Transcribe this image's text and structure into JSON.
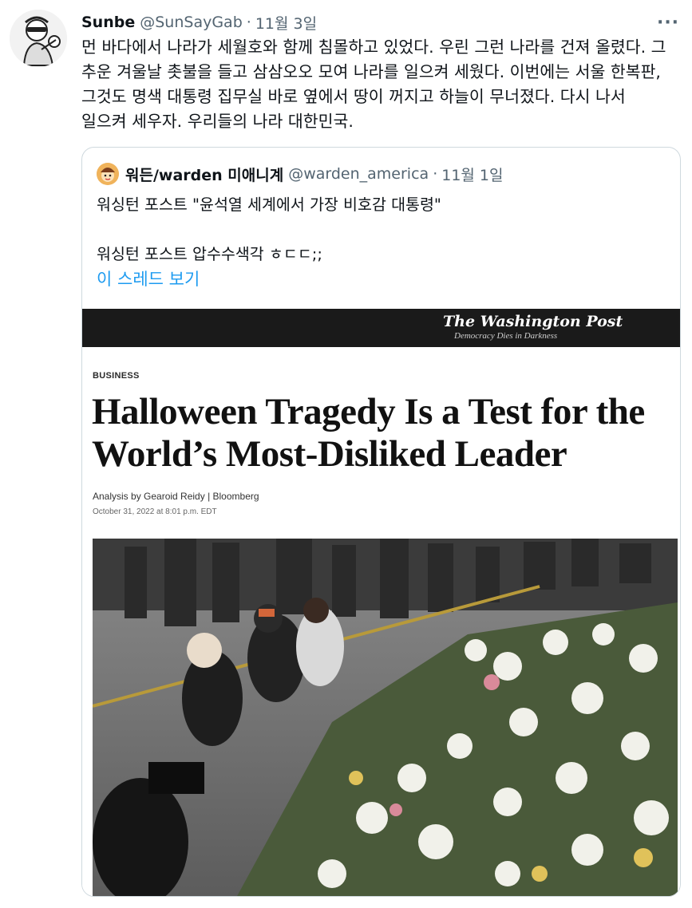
{
  "tweet": {
    "author_name": "Sunbe",
    "author_handle": "@SunSayGab",
    "separator": "·",
    "time": "11월 3일",
    "more_icon": "more-horizontal-icon",
    "text": "먼 바다에서 나라가 세월호와 함께 침몰하고 있었다. 우린 그런 나라를 건져 올렸다. 그 추운 겨울날 촛불을 들고 삼삼오오 모여 나라를 일으켜 세웠다. 이번에는 서울 한복판, 그것도 명색 대통령 집무실 바로 옆에서 땅이 꺼지고 하늘이 무너졌다. 다시 나서 일으켜 세우자. 우리들의 나라 대한민국."
  },
  "quoted_tweet": {
    "author_name": "워든/warden 미애니계",
    "author_handle": "@warden_america",
    "separator": "·",
    "time": "11월 1일",
    "line1": "워싱턴 포스트 \"윤석열 세계에서 가장 비호감 대통령\"",
    "line2": "",
    "line3": "워싱턴 포스트 압수수색각 ㅎㄷㄷ;;",
    "show_thread": "이 스레드 보기"
  },
  "article": {
    "publication": "The Washington Post",
    "tagline": "Democracy Dies in Darkness",
    "section": "BUSINESS",
    "headline": "Halloween Tragedy Is a Test for the World’s Most-Disliked Leader",
    "byline": "Analysis by Gearoid Reidy | Bloomberg",
    "date": "October 31, 2022 at 8:01 p.m. EDT"
  },
  "colors": {
    "text": "#0f1419",
    "secondary": "#536471",
    "link": "#1d9bf0",
    "border": "#cfd9de",
    "wapo_bar": "#1a1a1a"
  }
}
